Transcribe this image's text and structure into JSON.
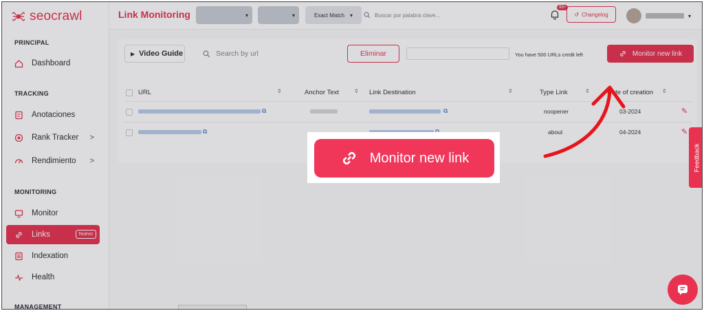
{
  "app": {
    "name": "seocrawl"
  },
  "sidebar": {
    "sections": [
      {
        "title": "PRINCIPAL",
        "items": [
          {
            "label": "Dashboard",
            "icon": "home-icon"
          }
        ]
      },
      {
        "title": "TRACKING",
        "items": [
          {
            "label": "Anotaciones",
            "icon": "annotation-icon"
          },
          {
            "label": "Rank Tracker",
            "icon": "target-icon",
            "chevron": ">"
          },
          {
            "label": "Rendimiento",
            "icon": "performance-icon",
            "chevron": ">"
          }
        ]
      },
      {
        "title": "MONITORING",
        "items": [
          {
            "label": "Monitor",
            "icon": "monitor-icon"
          },
          {
            "label": "Links",
            "icon": "link-icon",
            "badge": "Nuevo",
            "active": true
          },
          {
            "label": "Indexation",
            "icon": "index-icon"
          },
          {
            "label": "Health",
            "icon": "health-icon"
          }
        ]
      },
      {
        "title": "MANAGEMENT",
        "items": []
      }
    ]
  },
  "header": {
    "title": "Link Monitoring",
    "match_select": "Exact Match",
    "search_placeholder": "Buscar por palabra clave...",
    "notifications_badge": "99+",
    "changelog_label": "Changelog"
  },
  "toolbar": {
    "video_guide": "Video Guide",
    "search_placeholder": "Search by url",
    "delete_label": "Eliminar",
    "credits_text": "You have 500 URLs credit left",
    "monitor_label": "Monitor new link"
  },
  "table": {
    "columns": [
      "URL",
      "Anchor Text",
      "Link Destination",
      "Type Link",
      "Date of creation"
    ],
    "rows": [
      {
        "type_link": "noopener",
        "date": "03-2024"
      },
      {
        "type_link": "about",
        "date": "04-2024"
      }
    ]
  },
  "callout": {
    "label": "Monitor new link"
  },
  "feedback_label": "Feedback",
  "colors": {
    "accent": "#e8324f",
    "link": "#1f66c9",
    "callout": "#f0375a"
  }
}
